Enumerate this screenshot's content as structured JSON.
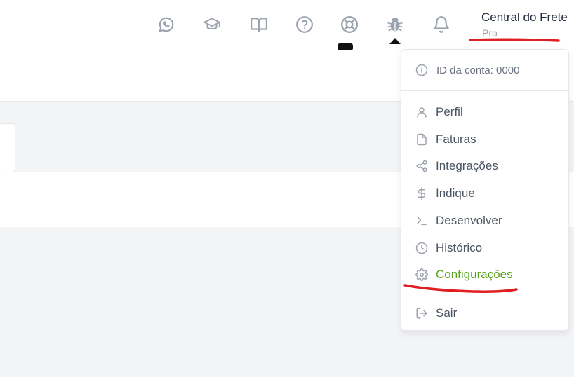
{
  "header": {
    "icons": [
      "whatsapp-icon",
      "graduation-cap-icon",
      "book-icon",
      "help-icon",
      "lifebuoy-icon",
      "bug-icon",
      "bell-icon"
    ],
    "user": {
      "name": "Central do Frete",
      "plan": "Pro"
    }
  },
  "dropdown": {
    "account_label": "ID da conta: 0000",
    "items": [
      {
        "label": "Perfil",
        "icon": "user-icon"
      },
      {
        "label": "Faturas",
        "icon": "file-icon"
      },
      {
        "label": "Integrações",
        "icon": "share-icon"
      },
      {
        "label": "Indique",
        "icon": "dollar-icon"
      },
      {
        "label": "Desenvolver",
        "icon": "terminal-icon"
      },
      {
        "label": "Histórico",
        "icon": "clock-icon"
      },
      {
        "label": "Configurações",
        "icon": "gear-icon",
        "active": true
      }
    ],
    "logout_label": "Sair"
  },
  "colors": {
    "accent_green": "#5aa51f",
    "annotation_red": "#e02020",
    "icon_gray": "#9ca3af"
  }
}
